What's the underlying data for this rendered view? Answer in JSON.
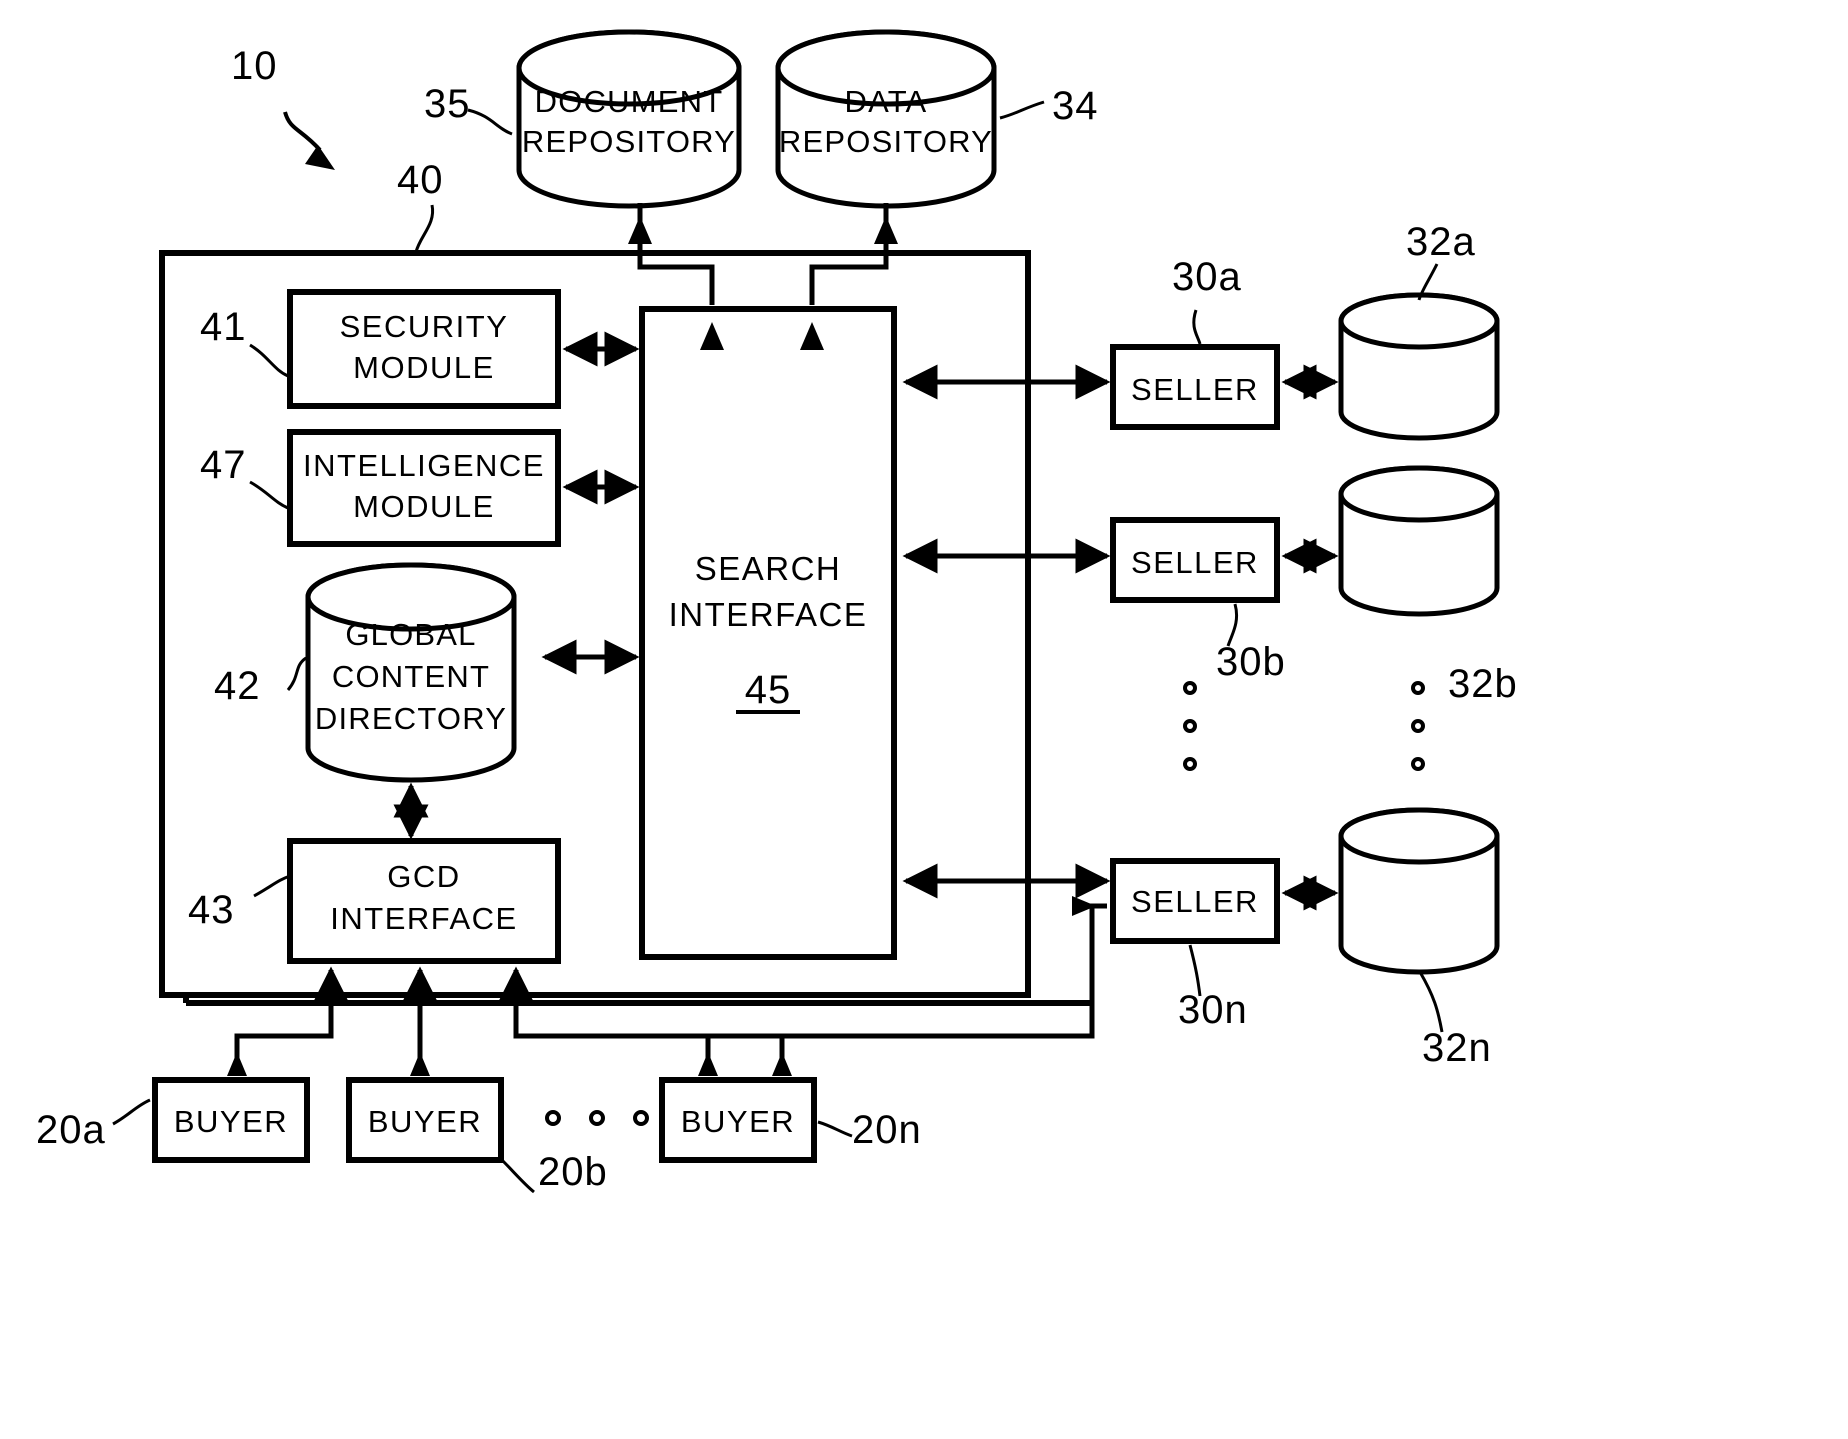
{
  "figure": {
    "system_ref": "10",
    "platform_ref": "40"
  },
  "repositories": [
    {
      "name": "document-repository",
      "line1": "DOCUMENT",
      "line2": "REPOSITORY",
      "ref": "35"
    },
    {
      "name": "data-repository",
      "line1": "DATA",
      "line2": "REPOSITORY",
      "ref": "34"
    }
  ],
  "platform_modules": [
    {
      "name": "security-module",
      "line1": "SECURITY",
      "line2": "MODULE",
      "ref": "41"
    },
    {
      "name": "intelligence-module",
      "line1": "INTELLIGENCE",
      "line2": "MODULE",
      "ref": "47"
    }
  ],
  "global_content_directory": {
    "line1": "GLOBAL",
    "line2": "CONTENT",
    "line3": "DIRECTORY",
    "ref": "42"
  },
  "gcd_interface": {
    "line1": "GCD",
    "line2": "INTERFACE",
    "ref": "43"
  },
  "search_interface": {
    "line1": "SEARCH",
    "line2": "INTERFACE",
    "ref": "45"
  },
  "sellers": [
    {
      "label": "SELLER",
      "ref": "30a"
    },
    {
      "label": "SELLER",
      "ref": "30b"
    },
    {
      "label": "SELLER",
      "ref": "30n"
    }
  ],
  "seller_databases": [
    {
      "ref": "32a"
    },
    {
      "ref": "32b"
    },
    {
      "ref": "32n"
    }
  ],
  "buyers": [
    {
      "label": "BUYER",
      "ref": "20a"
    },
    {
      "label": "BUYER",
      "ref": "20b"
    },
    {
      "label": "BUYER",
      "ref": "20n"
    }
  ],
  "ellipsis": {
    "glyph": "o",
    "buyer_row_count": 3,
    "seller_col_count": 3,
    "seller_db_col_count": 3
  },
  "colors": {
    "ink": "#000000",
    "paper": "#ffffff"
  }
}
